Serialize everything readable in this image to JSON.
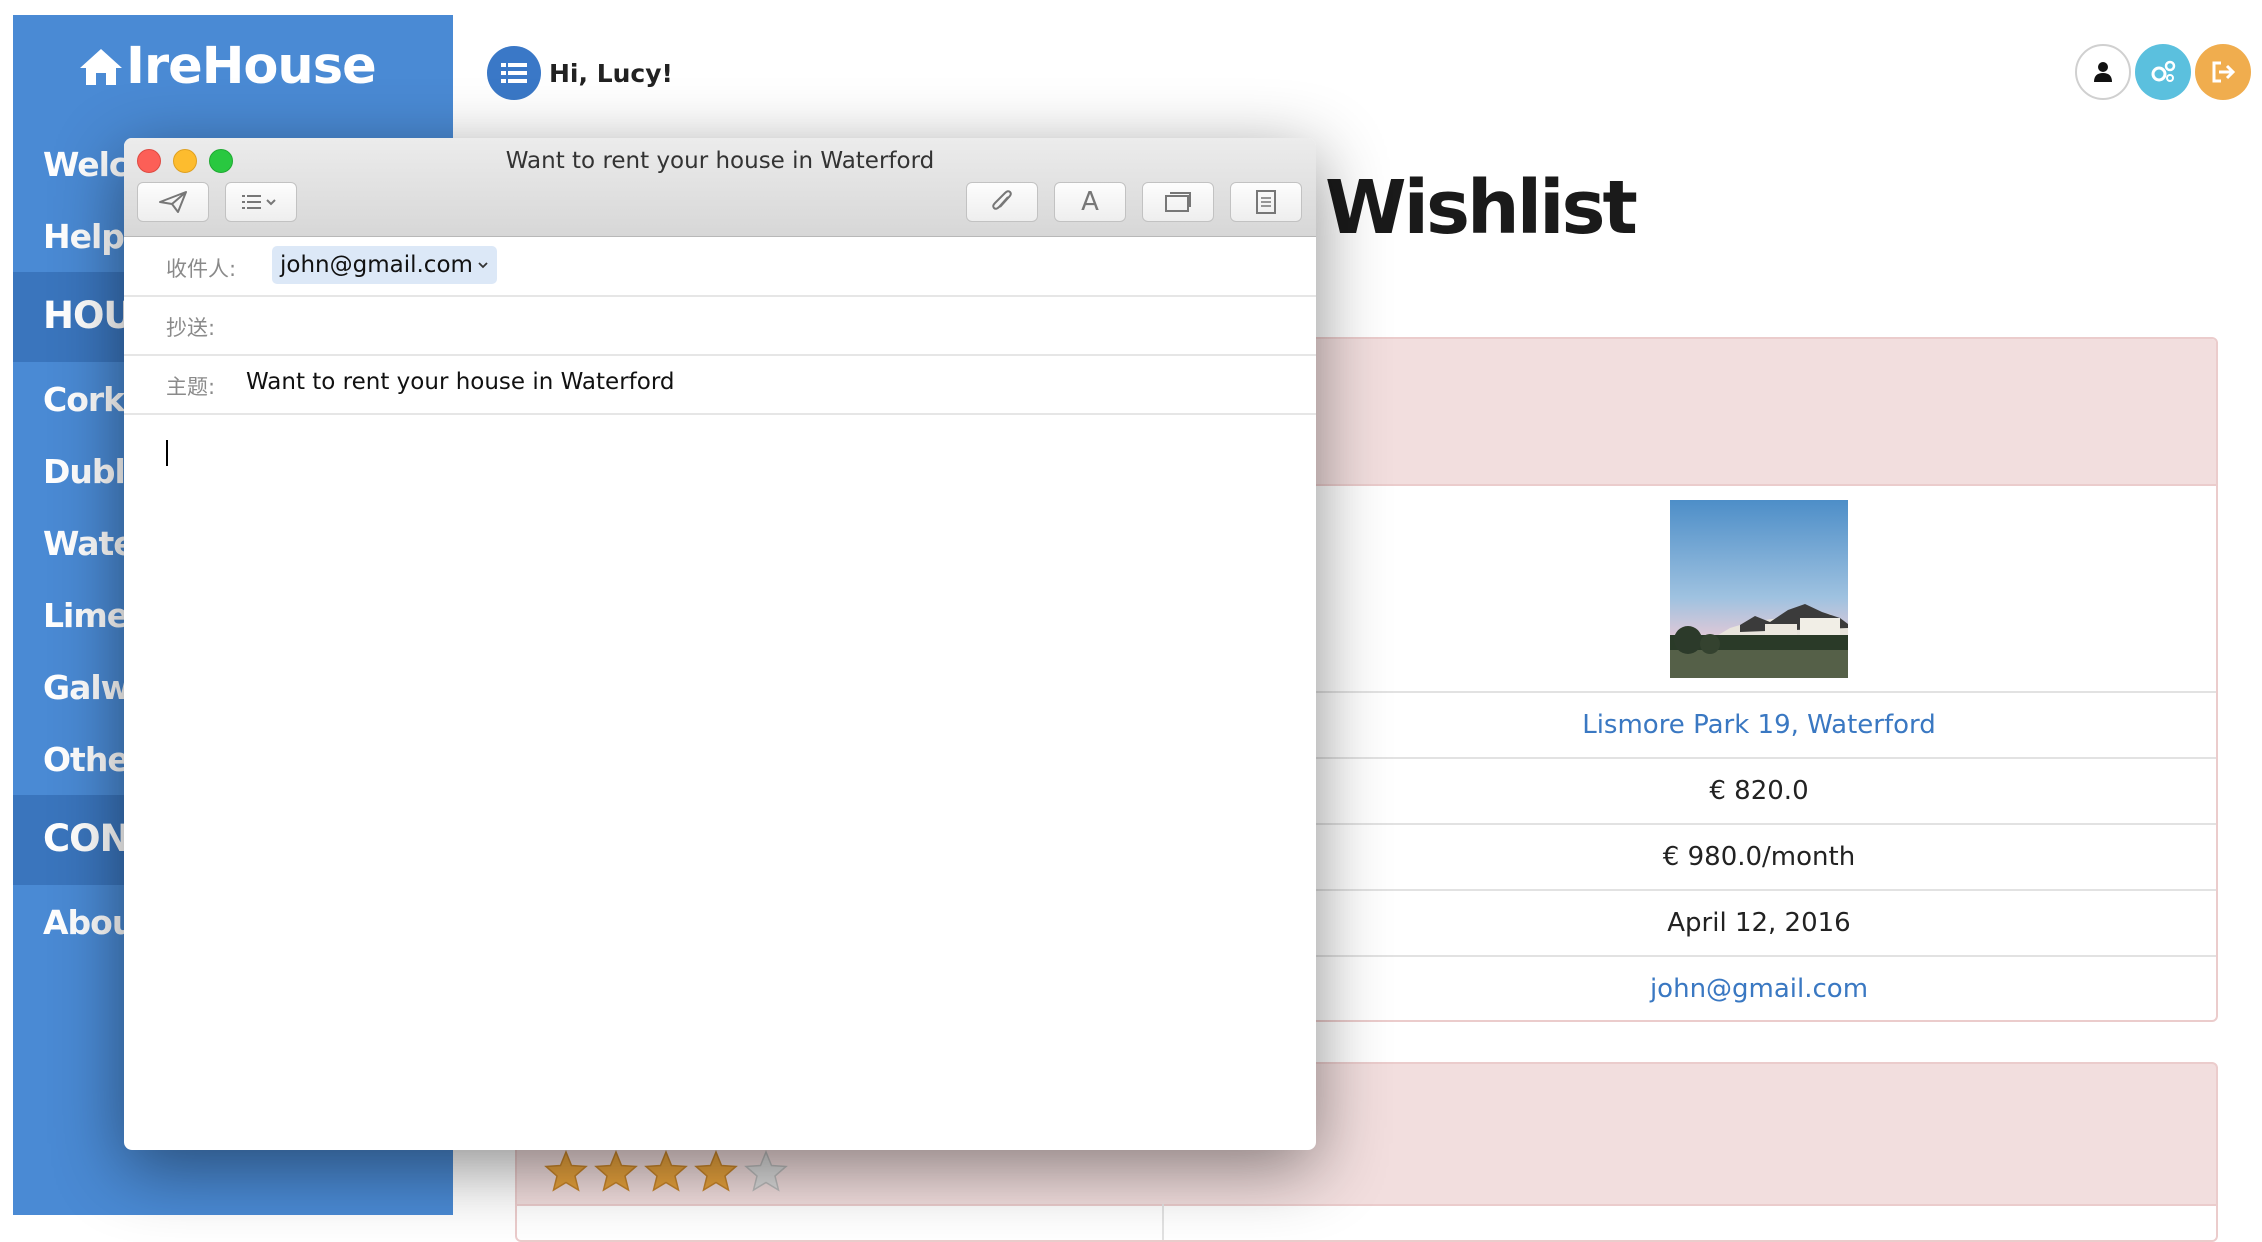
{
  "sidebar": {
    "logo": "IreHouse",
    "welcome": "Welcome",
    "help": "Help",
    "section_houses": "HOUSES",
    "cities": [
      "Cork",
      "Dublin",
      "Waterford",
      "Limerick",
      "Galway",
      "Other"
    ],
    "section_contact": "CONTACT",
    "about": "About"
  },
  "header": {
    "greeting": "Hi, Lucy!",
    "buttons": [
      "user-icon",
      "settings-icon",
      "logout-icon"
    ]
  },
  "page": {
    "title": "Wishlist"
  },
  "listing": {
    "address": "Lismore Park 19, Waterford",
    "deposit": "€ 820.0",
    "rent": "€ 980.0/month",
    "date": "April 12, 2016",
    "email": "john@gmail.com"
  },
  "rating": {
    "value": 4,
    "max": 5
  },
  "mail": {
    "window_title": "Want to rent your house in Waterford",
    "to_label": "收件人:",
    "to_value": "john@gmail.com",
    "cc_label": "抄送:",
    "subject_label": "主题:",
    "subject_value": "Want to rent your house in Waterford",
    "body": ""
  },
  "colors": {
    "sidebar": "#4a8ad4",
    "sidebar_section": "#3a75bd",
    "panel_heading": "#f2dede",
    "link": "#3a78c2",
    "settings_button": "#5bc0de",
    "logout_button": "#f0ad4e",
    "star": "#e8a33d"
  }
}
